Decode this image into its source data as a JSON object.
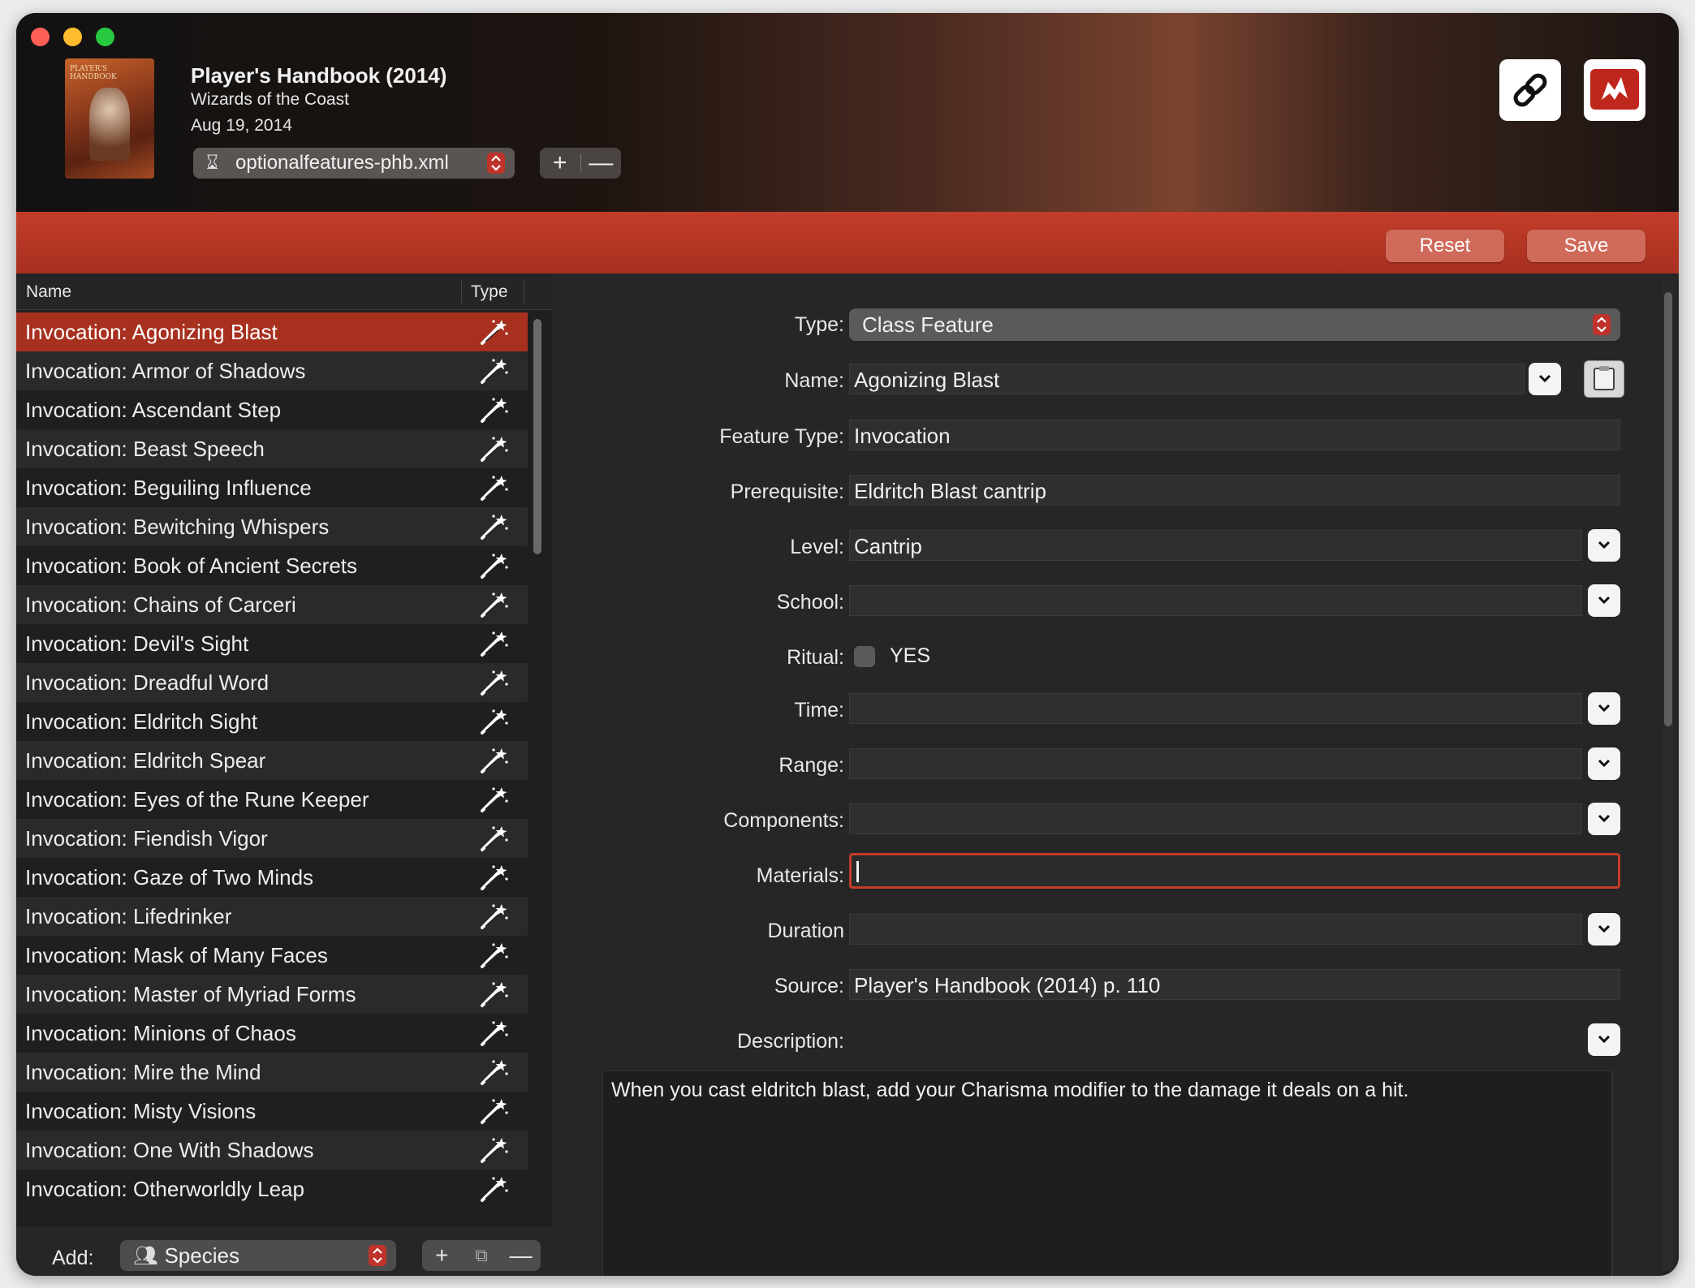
{
  "book": {
    "title": "Player's Handbook (2014)",
    "publisher": "Wizards of the Coast",
    "date": "Aug 19, 2014",
    "cover_text": "PLAYER'S HANDBOOK"
  },
  "file_selector": {
    "value": "optionalfeatures-phb.xml",
    "icon": "hourglass-icon"
  },
  "file_buttons": {
    "add": "+",
    "remove": "—"
  },
  "toolbar": {
    "reset_label": "Reset",
    "save_label": "Save"
  },
  "list": {
    "headers": {
      "name": "Name",
      "type": "Type"
    },
    "items": [
      "Invocation: Agonizing Blast",
      "Invocation: Armor of Shadows",
      "Invocation: Ascendant Step",
      "Invocation: Beast Speech",
      "Invocation: Beguiling Influence",
      "Invocation: Bewitching Whispers",
      "Invocation: Book of Ancient Secrets",
      "Invocation: Chains of Carceri",
      "Invocation: Devil's Sight",
      "Invocation: Dreadful Word",
      "Invocation: Eldritch Sight",
      "Invocation: Eldritch Spear",
      "Invocation: Eyes of the Rune Keeper",
      "Invocation: Fiendish Vigor",
      "Invocation: Gaze of Two Minds",
      "Invocation: Lifedrinker",
      "Invocation: Mask of Many Faces",
      "Invocation: Master of Myriad Forms",
      "Invocation: Minions of Chaos",
      "Invocation: Mire the Mind",
      "Invocation: Misty Visions",
      "Invocation: One With Shadows",
      "Invocation: Otherworldly Leap"
    ],
    "selected_index": 0,
    "item_icon": "magic-wand-icon"
  },
  "footer": {
    "add_label": "Add:",
    "species_value": "Species",
    "buttons": {
      "add": "+",
      "duplicate": "⧉",
      "remove": "—"
    }
  },
  "form": {
    "type": {
      "label": "Type:",
      "value": "Class Feature"
    },
    "name": {
      "label": "Name:",
      "value": "Agonizing Blast"
    },
    "feature_type": {
      "label": "Feature Type:",
      "value": "Invocation"
    },
    "prerequisite": {
      "label": "Prerequisite:",
      "value": "Eldritch Blast cantrip"
    },
    "level": {
      "label": "Level:",
      "value": "Cantrip"
    },
    "school": {
      "label": "School:",
      "value": ""
    },
    "ritual": {
      "label": "Ritual:",
      "checkbox_label": "YES"
    },
    "time": {
      "label": "Time:",
      "value": ""
    },
    "range": {
      "label": "Range:",
      "value": ""
    },
    "components": {
      "label": "Components:",
      "value": ""
    },
    "materials": {
      "label": "Materials:",
      "value": ""
    },
    "duration": {
      "label": "Duration",
      "value": ""
    },
    "source": {
      "label": "Source:",
      "value": "Player's Handbook (2014) p. 110"
    },
    "description": {
      "label": "Description:",
      "value": "When you cast eldritch blast, add your Charisma modifier to the damage it deals on a hit."
    }
  },
  "colors": {
    "accent": "#a8301f",
    "close": "#ff5f57",
    "minimize": "#febc2e",
    "zoom": "#28c840"
  }
}
